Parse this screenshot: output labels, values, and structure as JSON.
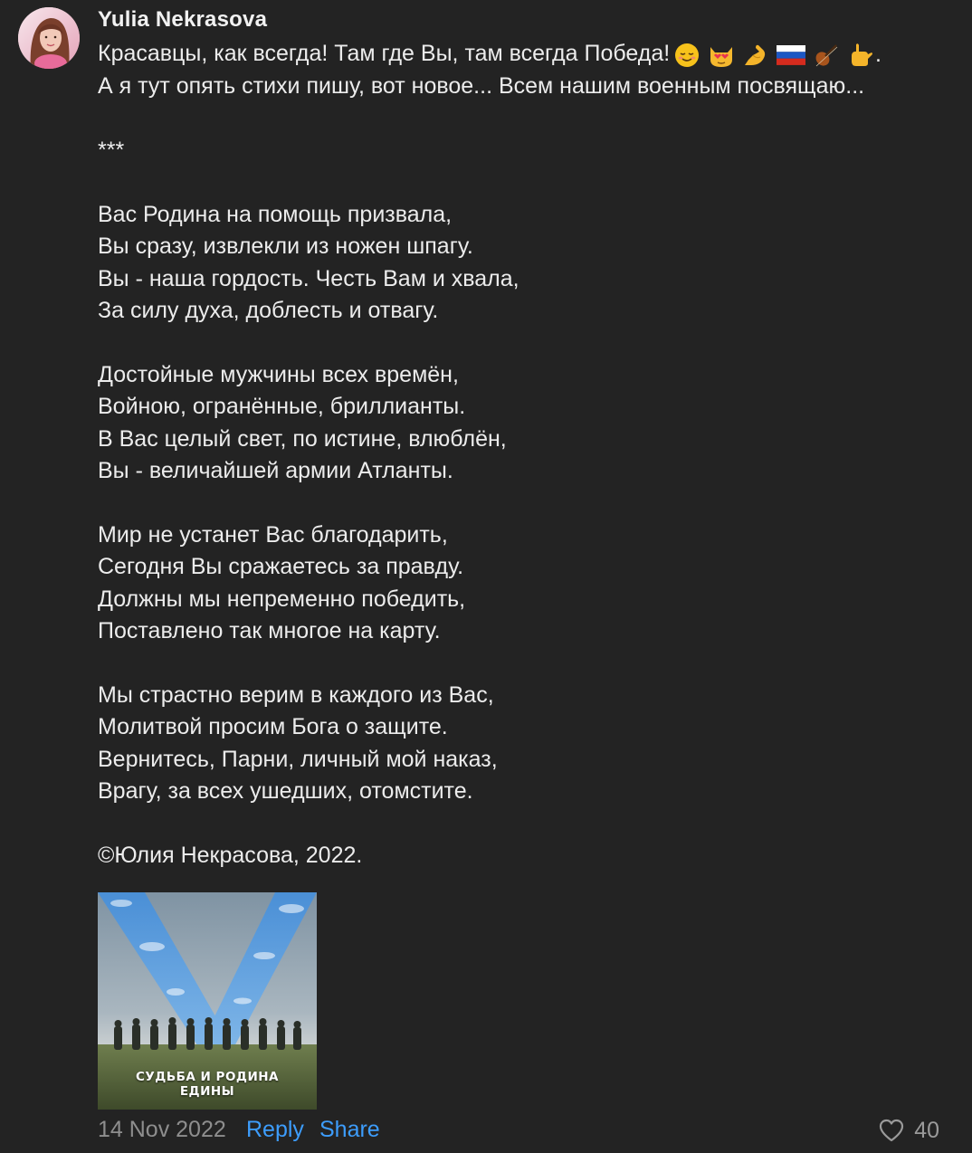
{
  "comment": {
    "author": "Yulia Nekrasova",
    "lines": [
      "Красавцы, как всегда! Там где Вы, там всегда Победа!",
      "А я тут опять стихи пишу, вот новое... Всем нашим военным посвящаю...",
      "",
      "***",
      "",
      "Вас Родина на помощь призвала,",
      "Вы сразу, извлекли из ножен шпагу.",
      "Вы - наша гордость. Честь Вам и хвала,",
      "За силу духа, доблесть и отвагу.",
      "",
      "Достойные мужчины всех времён,",
      "Войною, огранённые, бриллианты.",
      "В Вас целый свет, по истине, влюблён,",
      "Вы - величайшей армии Атланты.",
      "",
      "Мир не устанет Вас благодарить,",
      "Сегодня Вы сражаетесь за правду.",
      "Должны мы непременно победить,",
      "Поставлено так многое на карту.",
      "",
      "Мы страстно верим в каждого из Вас,",
      "Молитвой просим Бога о защите.",
      "Вернитесь, Парни, личный мой наказ,",
      "Врагу, за всех ушедших, отомстите.",
      "",
      "©Юлия Некрасова, 2022."
    ],
    "emoji_suffix": ".",
    "emojis": [
      "relieved-face",
      "heart-eyes-cat",
      "flexed-biceps",
      "russia-flag",
      "violin",
      "call-me-hand"
    ],
    "attachment": {
      "caption_line1": "СУДЬБА И РОДИНА",
      "caption_line2": "ЕДИНЫ"
    },
    "footer": {
      "date": "14 Nov 2022",
      "reply_label": "Reply",
      "share_label": "Share",
      "like_count": "40",
      "like_icon": "heart-outline-icon"
    }
  }
}
